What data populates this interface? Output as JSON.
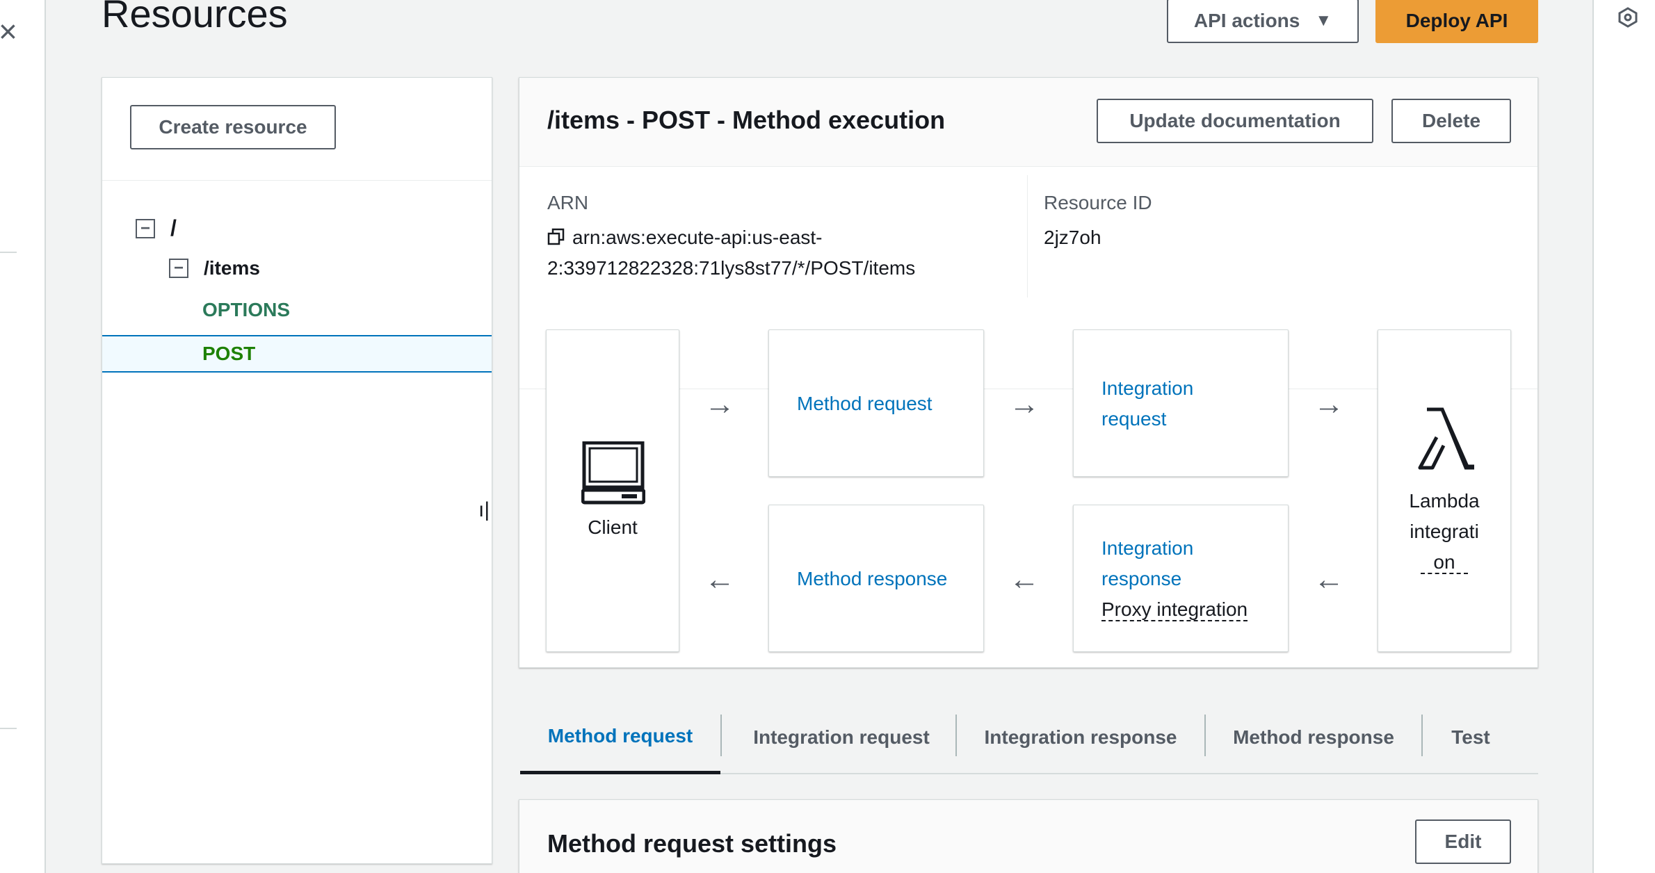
{
  "header": {
    "title": "Resources",
    "api_actions_label": "API actions",
    "deploy_label": "Deploy API"
  },
  "tree": {
    "create_label": "Create resource",
    "root": "/",
    "items": "/items",
    "methods": [
      "OPTIONS",
      "POST"
    ],
    "selected": "POST"
  },
  "execution": {
    "title": "/items - POST - Method execution",
    "update_doc_label": "Update documentation",
    "delete_label": "Delete",
    "arn_label": "ARN",
    "arn_line1": "arn:aws:execute-api:us-east-",
    "arn_line2": "2:339712822328:71lys8st77/*/POST/items",
    "resource_id_label": "Resource ID",
    "resource_id": "2jz7oh",
    "client_label": "Client",
    "method_request": "Method request",
    "integration_request_1": "Integration",
    "integration_request_2": "request",
    "method_response": "Method response",
    "integration_response_1": "Integration",
    "integration_response_2": "response",
    "proxy_label": "Proxy integration",
    "lambda_1": "Lambda",
    "lambda_2": "integrati",
    "lambda_3": "on"
  },
  "tabs": [
    "Method request",
    "Integration request",
    "Integration response",
    "Method response",
    "Test"
  ],
  "active_tab": "Method request",
  "settings": {
    "title": "Method request settings",
    "edit_label": "Edit"
  },
  "colors": {
    "accent_link": "#0073bb",
    "deploy_button": "#ec9c35",
    "method_green": "#1d8102"
  }
}
